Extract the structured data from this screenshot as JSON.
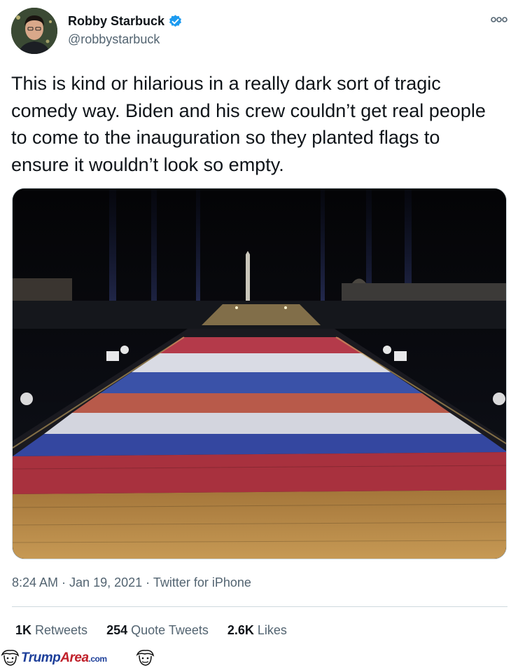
{
  "author": {
    "name": "Robby Starbuck",
    "handle": "@robbystarbuck",
    "verified": true,
    "verified_color": "#1d9bf0"
  },
  "tweet": {
    "text": "This is kind or hilarious in a really dark sort of tragic comedy way. Biden and his crew couldn’t get real people to come to the inauguration so they planted flags to ensure it wouldn’t look so empty.",
    "time": "8:24 AM",
    "date": "Jan 19, 2021",
    "source": "Twitter for iPhone",
    "separator": " · "
  },
  "stats": {
    "retweets_count": "1K",
    "retweets_label": " Retweets",
    "quotes_count": "254",
    "quotes_label": " Quote Tweets",
    "likes_count": "2.6K",
    "likes_label": " Likes"
  },
  "icons": {
    "more": "more-icon",
    "verified": "verified-badge-icon"
  },
  "watermark": {
    "part1": "Trump",
    "part2": "Area",
    "part3": ".com"
  },
  "colors": {
    "text": "#0f1419",
    "secondary": "#536471",
    "divider": "#cfd9de",
    "flag_red": "#b43a4a",
    "flag_blue": "#3a52a8",
    "flag_white": "#d9dbe4"
  }
}
